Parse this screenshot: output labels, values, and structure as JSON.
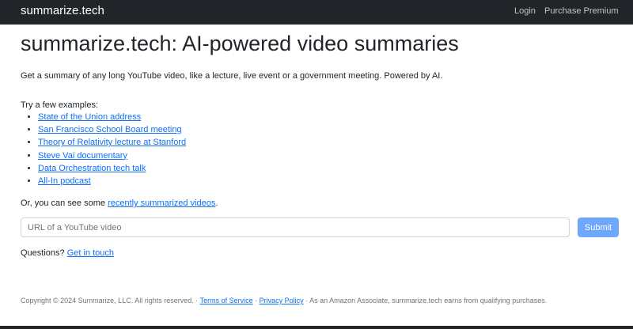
{
  "navbar": {
    "brand": "summarize.tech",
    "login": "Login",
    "premium": "Purchase Premium"
  },
  "main": {
    "title": "summarize.tech: AI-powered video summaries",
    "lead": "Get a summary of any long YouTube video, like a lecture, live event or a government meeting. Powered by AI.",
    "examples_label": "Try a few examples:",
    "examples": [
      "State of the Union address",
      "San Francisco School Board meeting",
      "Theory of Relativity lecture at Stanford",
      "Steve Vai documentary",
      "Data Orchestration tech talk",
      "All-In podcast"
    ],
    "recent_prefix": "Or, you can see some ",
    "recent_link": "recently summarized videos",
    "recent_suffix": ".",
    "url_placeholder": "URL of a YouTube video",
    "url_value": "",
    "submit_label": "Submit",
    "questions_prefix": "Questions? ",
    "questions_link": "Get in touch"
  },
  "footer": {
    "copyright": "Copyright © 2024 Summarize, LLC. All rights reserved. · ",
    "terms": "Terms of Service",
    "sep": " · ",
    "privacy": "Privacy Policy",
    "affiliate": " · As an Amazon Associate, summarize.tech earns from qualifying purchases."
  },
  "colors": {
    "navbar_bg": "#212529",
    "link": "#0d6efd",
    "submit_bg": "#6ea8fe"
  }
}
